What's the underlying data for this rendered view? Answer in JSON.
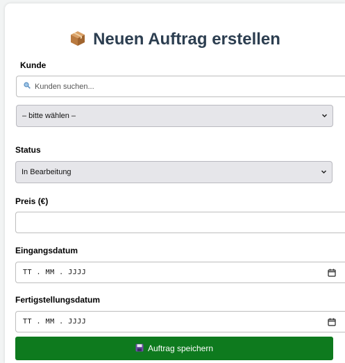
{
  "title": "Neuen Auftrag erstellen",
  "customer": {
    "label": "Kunde",
    "search_placeholder": "Kunden suchen...",
    "select_value": "– bitte wählen –"
  },
  "status": {
    "label": "Status",
    "select_value": "In Bearbeitung"
  },
  "price": {
    "label": "Preis (€)",
    "value": ""
  },
  "received_date": {
    "label": "Eingangsdatum",
    "placeholder": "TT . MM . JJJJ"
  },
  "completion_date": {
    "label": "Fertigstellungsdatum",
    "placeholder": "TT . MM . JJJJ"
  },
  "save_button": {
    "label": "Auftrag speichern"
  },
  "colors": {
    "title": "#2c3e50",
    "save_button": "#0e7a1e",
    "select_background": "#e6e6ea"
  },
  "icons": {
    "title": "package-icon",
    "search": "search-icon",
    "select": "chevron-down-icon",
    "date": "calendar-icon",
    "save": "floppy-disk-icon"
  }
}
